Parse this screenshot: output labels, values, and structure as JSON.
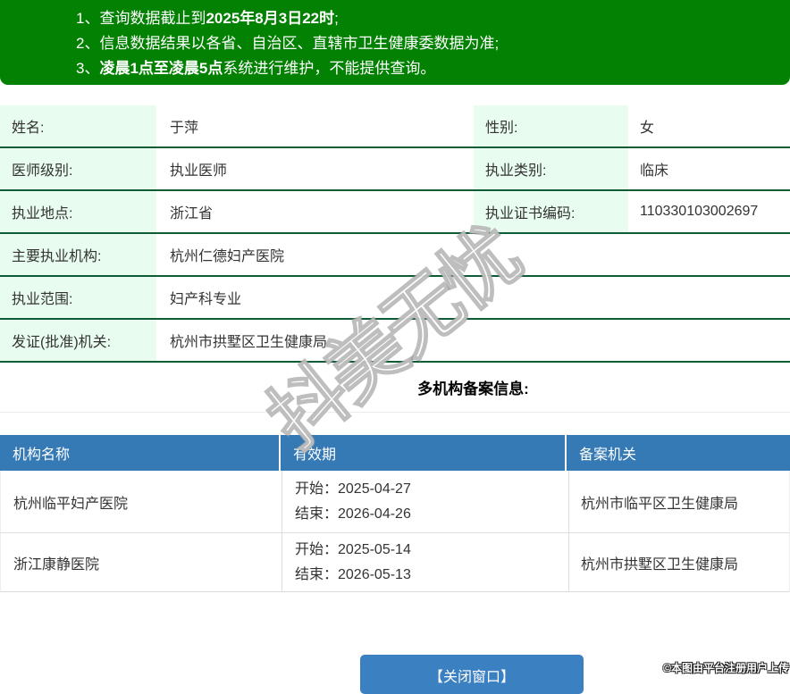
{
  "colors": {
    "banner_green": "#028102",
    "border_green": "#0e5c36",
    "label_bg": "#e8fcf0",
    "header_blue": "#3579b5",
    "button_blue": "#3b80c0"
  },
  "notices": {
    "lines": [
      {
        "num": "1、",
        "pre": "查询数据截止到",
        "bold": "2025年8月3日22时",
        "post": ";"
      },
      {
        "num": "2、",
        "pre": "信息数据结果以各省、自治区、直辖市卫生健康委数据为准;",
        "bold": "",
        "post": ""
      },
      {
        "num": "3、",
        "pre": "",
        "bold": "凌晨1点至凌晨5点",
        "post": "系统进行维护，不能提供查询。"
      }
    ]
  },
  "info": {
    "rows": [
      {
        "l1": "姓名:",
        "v1": "于萍",
        "l2": "性别:",
        "v2": "女"
      },
      {
        "l1": "医师级别:",
        "v1": "执业医师",
        "l2": "执业类别:",
        "v2": "临床"
      },
      {
        "l1": "执业地点:",
        "v1": "浙江省",
        "l2": "执业证书编码:",
        "v2": "110330103002697"
      },
      {
        "l1": "主要执业机构:",
        "v1": "杭州仁德妇产医院"
      },
      {
        "l1": "执业范围:",
        "v1": "妇产科专业"
      },
      {
        "l1": "发证(批准)机关:",
        "v1": "杭州市拱墅区卫生健康局"
      }
    ]
  },
  "registration": {
    "title": "多机构备案信息:",
    "headers": [
      "机构名称",
      "有效期",
      "备案机关"
    ],
    "rows": [
      {
        "org": "杭州临平妇产医院",
        "start": "开始：2025-04-27",
        "end": "结束：2026-04-26",
        "authority": "杭州市临平区卫生健康局"
      },
      {
        "org": "浙江康静医院",
        "start": "开始：2025-05-14",
        "end": "结束：2026-05-13",
        "authority": "杭州市拱墅区卫生健康局"
      }
    ]
  },
  "watermark": {
    "diagonal": "抖美无忧",
    "upload_note": "©本图由平台注册用户上传"
  },
  "footer": {
    "close_label": "【关闭窗口】"
  }
}
